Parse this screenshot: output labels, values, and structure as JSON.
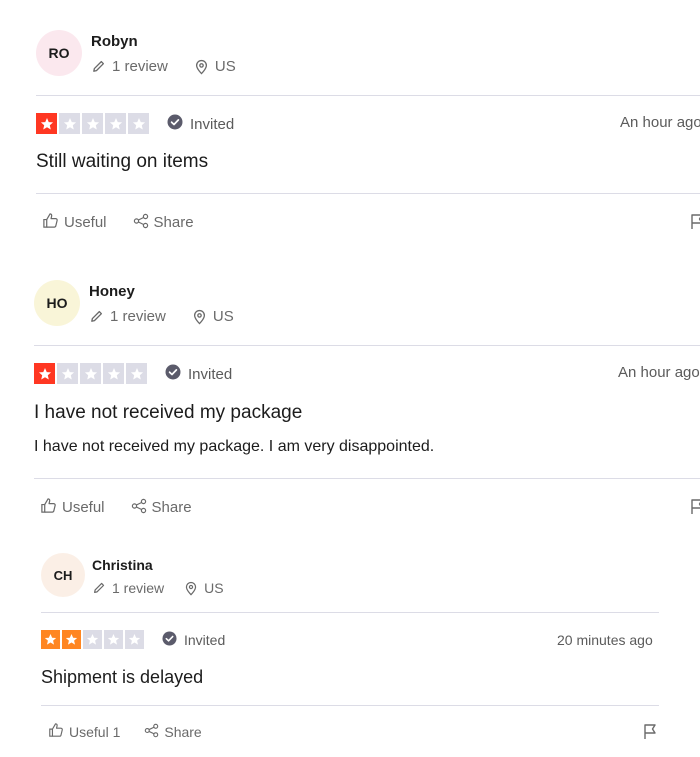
{
  "colors": {
    "star_red": "#ff3722",
    "star_orange": "#ff8622",
    "star_empty": "#dcdce6",
    "avatar_pink": "#fbe8ee",
    "avatar_yellow": "#f9f5d8",
    "avatar_peach": "#fbefe6"
  },
  "reviews": [
    {
      "initials": "RO",
      "name": "Robyn",
      "review_count": "1 review",
      "country": "US",
      "rating": 1,
      "invited_label": "Invited",
      "date": "An hour ago",
      "title": "Still waiting on items",
      "body": "",
      "useful_label": "Useful",
      "share_label": "Share"
    },
    {
      "initials": "HO",
      "name": "Honey",
      "review_count": "1 review",
      "country": "US",
      "rating": 1,
      "invited_label": "Invited",
      "date": "An hour ago",
      "title": "I have not received my package",
      "body": "I have not received my package. I am very disappointed.",
      "useful_label": "Useful",
      "share_label": "Share"
    },
    {
      "initials": "CH",
      "name": "Christina",
      "review_count": "1 review",
      "country": "US",
      "rating": 2,
      "invited_label": "Invited",
      "date": "20 minutes ago",
      "title": "Shipment is delayed",
      "body": "",
      "useful_label": "Useful 1",
      "share_label": "Share"
    }
  ]
}
